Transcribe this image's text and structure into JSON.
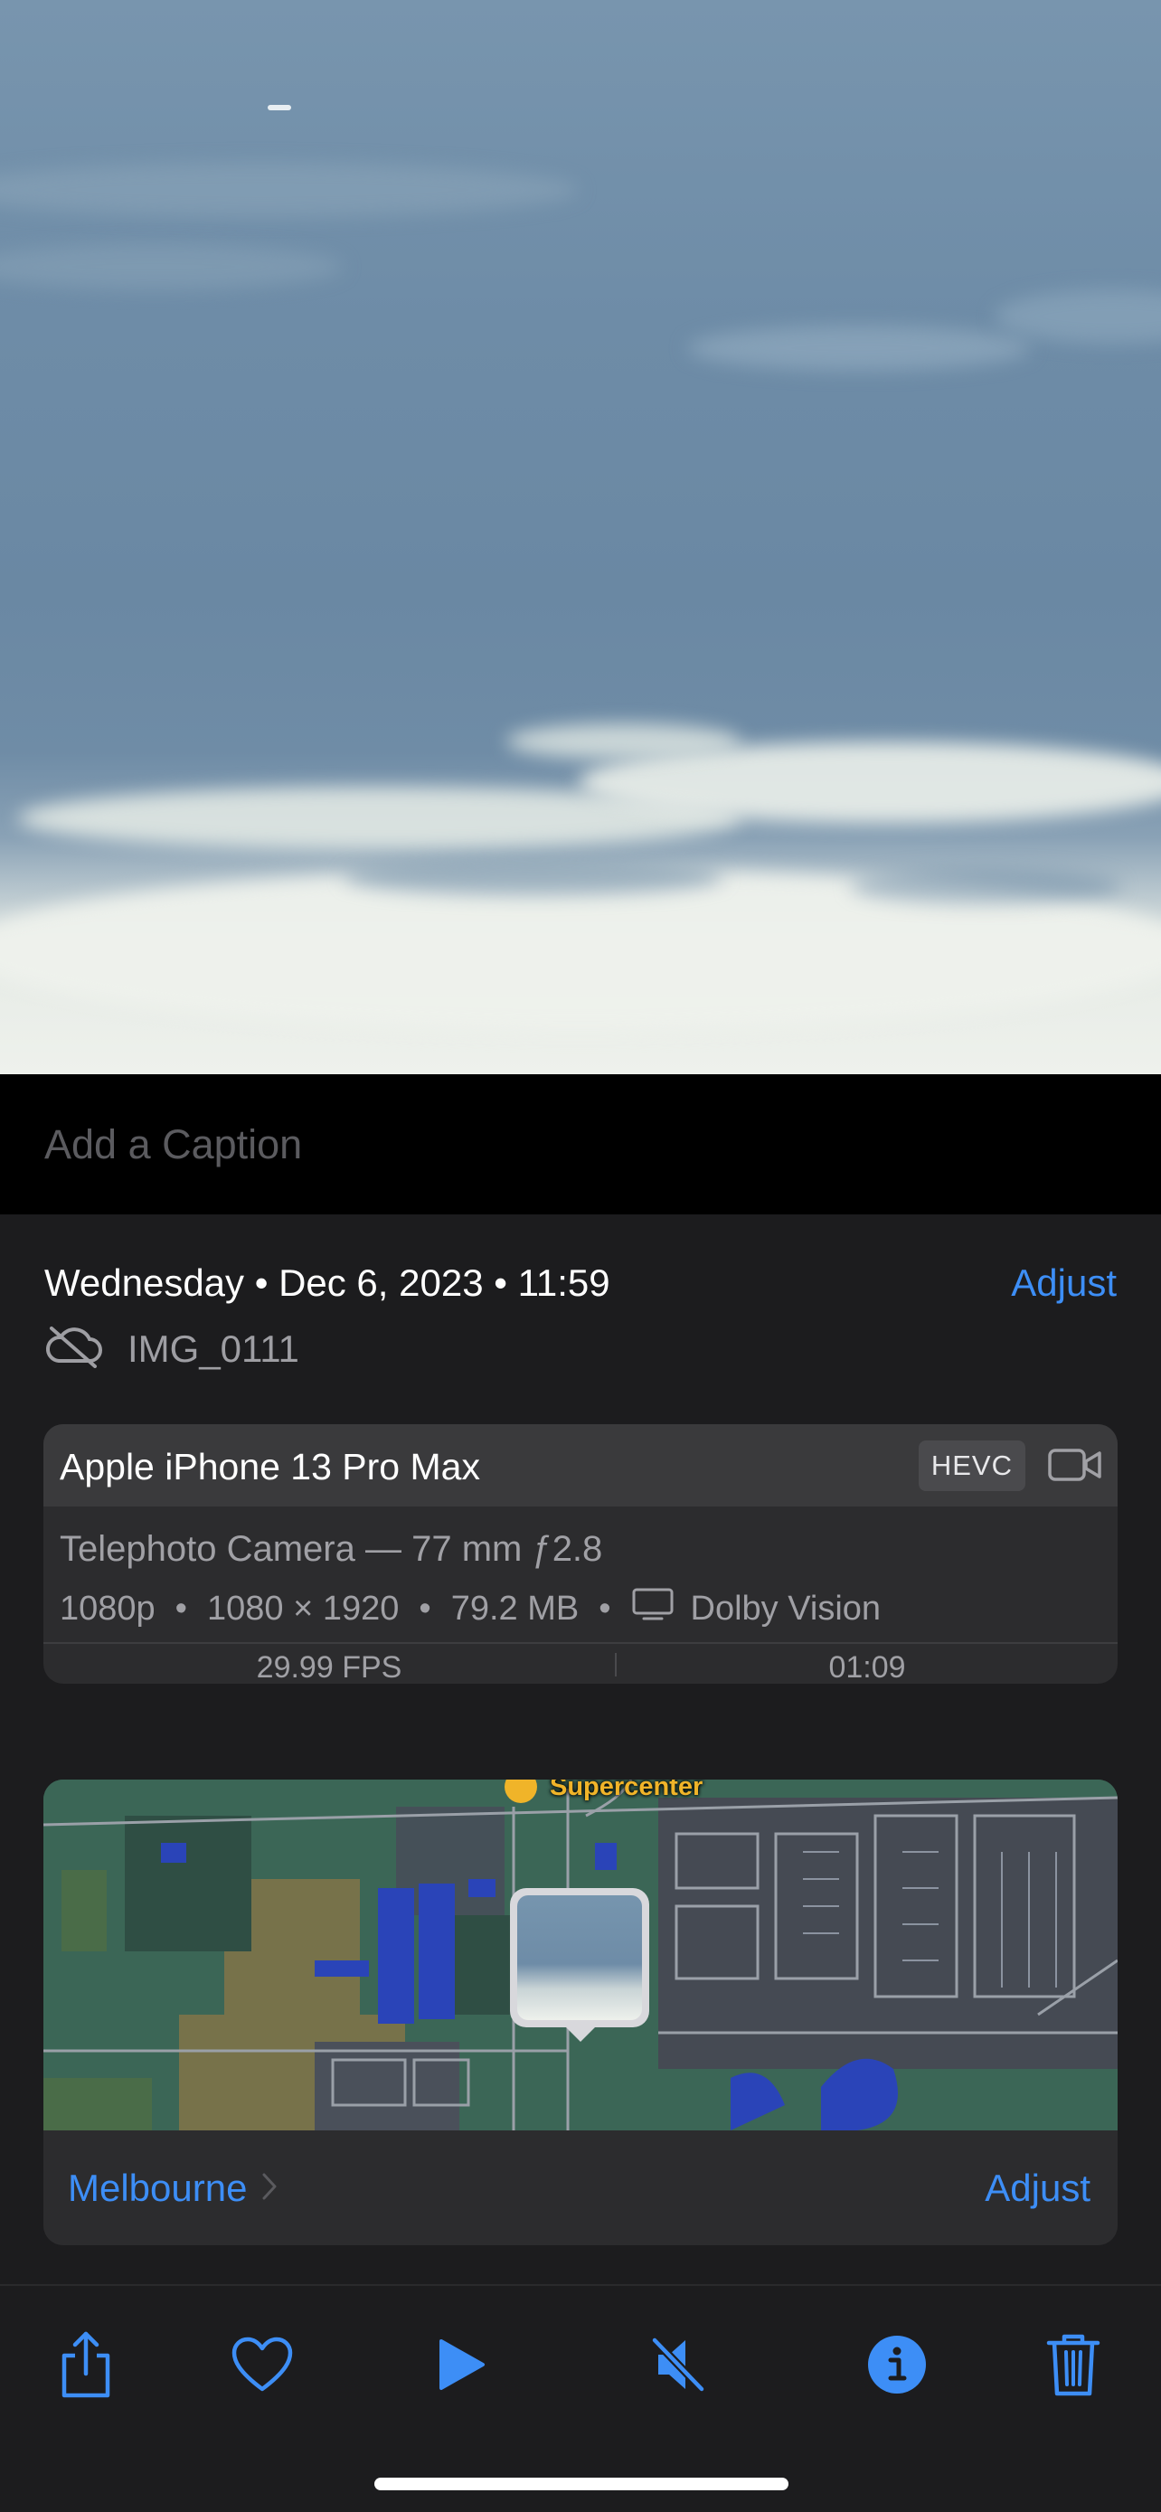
{
  "photo": {
    "description_icon": "sky-photo"
  },
  "caption": {
    "placeholder": "Add a Caption"
  },
  "info": {
    "date_line": "Wednesday • Dec 6, 2023 • 11:59",
    "adjust_label": "Adjust",
    "filename": "IMG_0111",
    "filename_icon": "cloud-slash-icon"
  },
  "camera": {
    "model": "Apple iPhone 13 Pro Max",
    "codec_badge": "HEVC",
    "lens": "Telephoto Camera — 77 mm ƒ2.8",
    "resolution": "1080p",
    "dimensions": "1080 × 1920",
    "size": "79.2 MB",
    "hdr": "Dolby Vision",
    "fps": "29.99 FPS",
    "duration": "01:09",
    "separator": "•"
  },
  "map": {
    "poi_label": "Supercenter",
    "city": "Melbourne",
    "adjust_label": "Adjust"
  },
  "toolbar": {
    "items": [
      "share-icon",
      "heart-icon",
      "play-icon",
      "mute-icon",
      "info-icon",
      "trash-icon"
    ],
    "accent": "#3d8ef6"
  }
}
